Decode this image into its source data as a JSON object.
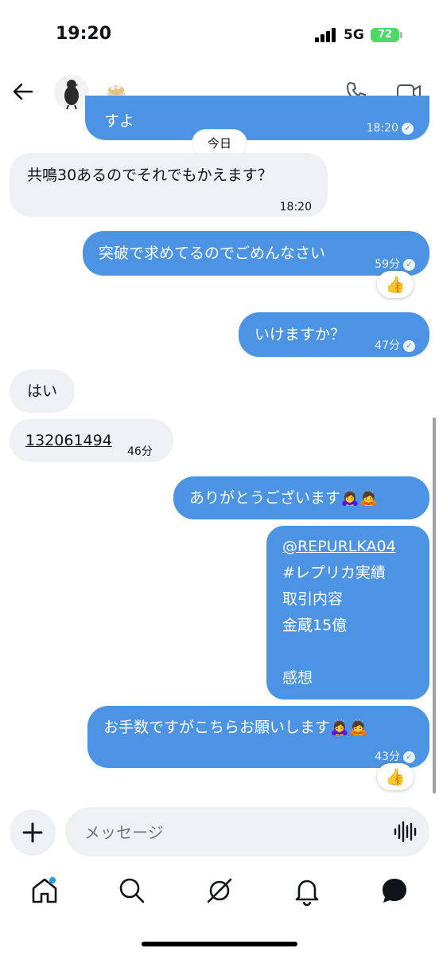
{
  "status_bar": {
    "time": "19:20",
    "network": "5G",
    "battery": "72"
  },
  "header": {
    "back_icon": "arrow-left-icon",
    "call_icon": "phone-icon",
    "video_icon": "video-camera-icon"
  },
  "top_partial": {
    "text": "すよ",
    "time": "18:20"
  },
  "day_separator": "今日",
  "messages": [
    {
      "dir": "in",
      "text": "共鳴30あるのでそれでもかえます？",
      "time": "18:20"
    },
    {
      "dir": "out",
      "text": "突破で求めてるのでごめんなさい",
      "time": "59分",
      "reaction": "👍"
    },
    {
      "dir": "out",
      "text": "いけますか？",
      "time": "47分"
    },
    {
      "dir": "in",
      "text": "はい"
    },
    {
      "dir": "in",
      "text": "132061494",
      "time": "46分"
    },
    {
      "dir": "out",
      "text": "ありがとうございます🙇‍♀️🙇"
    },
    {
      "dir": "out",
      "lines": [
        "@REPURLKA04",
        "#レプリカ実績",
        "取引内容",
        "金蔵15億",
        "",
        "感想"
      ]
    },
    {
      "dir": "out",
      "text": "お手数ですがこちらお願いします🙇‍♀️🙇",
      "time": "43分",
      "reaction": "👍"
    }
  ],
  "composer": {
    "placeholder": "メッセージ",
    "voice_icon": "waveform-icon",
    "add_icon": "plus-icon"
  },
  "tabbar": [
    "home-icon",
    "search-icon",
    "grok-icon",
    "notifications-icon",
    "messages-icon"
  ],
  "colors": {
    "accent": "#4c93e3",
    "incoming": "#eef1f3",
    "notification_dot": "#1d9bf0"
  }
}
